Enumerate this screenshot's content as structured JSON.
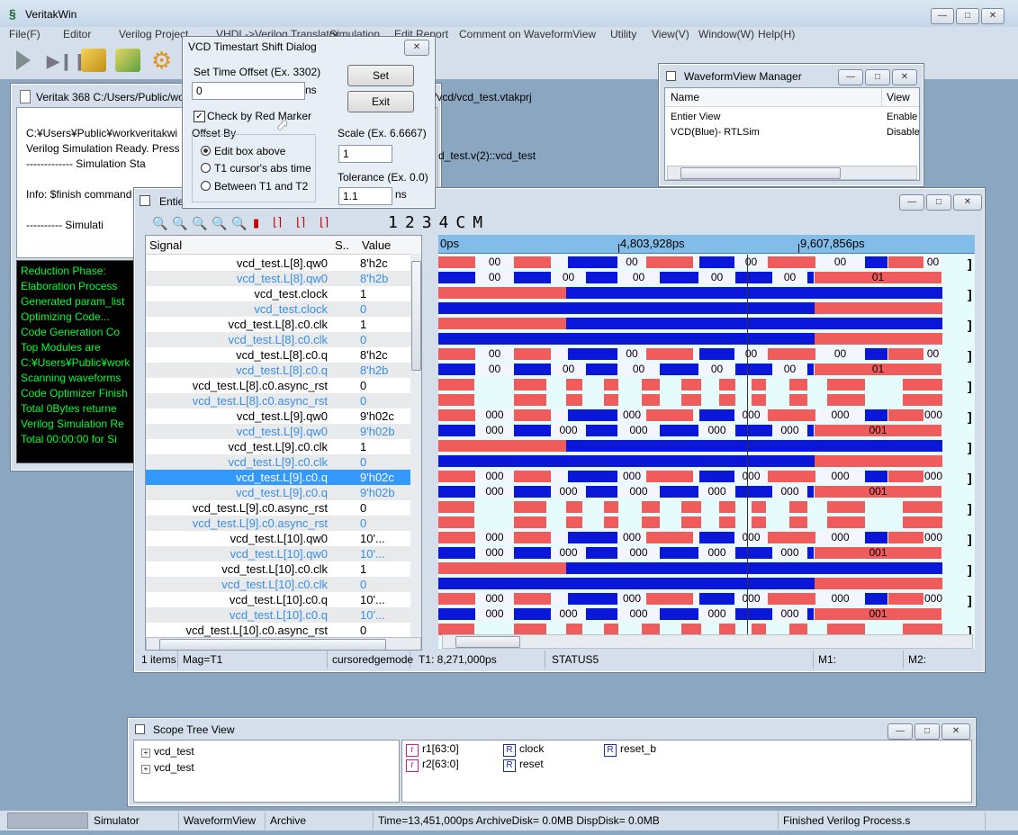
{
  "app": {
    "title": "VeritakWin",
    "menu": [
      "File(F)",
      "Editor",
      "Verilog Project",
      "VHDL->Verilog Translator",
      "Simulation",
      "Edit Report",
      "Comment on WaveformView",
      "Utility",
      "View(V)",
      "Window(W)",
      "Help(H)"
    ]
  },
  "console": {
    "title": "Veritak 368 C:/Users/Public/wo",
    "title_tail": "/vcd/vcd_test.vtakprj",
    "lines": [
      "C:¥Users¥Public¥workveritakwi",
      "Verilog Simulation Ready. Press",
      "------------- Simulation Sta",
      "",
      "Info: $finish command",
      "",
      "---------- Simulati"
    ],
    "line_tail": "d_test.v(2)::vcd_test"
  },
  "log": {
    "lines": [
      "Reduction Phase:",
      " Elaboration Process",
      "  Generated param_list",
      "  Optimizing Code...",
      " Code Generation Co",
      "Top Modules are",
      "C:¥Users¥Public¥work",
      "Scanning waveforms",
      "Code Optimizer Finish",
      "Total 0Bytes returne",
      "Verilog Simulation Re",
      "Total  00:00:00 for Si"
    ]
  },
  "dialog": {
    "title": "VCD Timestart Shift Dialog",
    "offset_label": "Set Time Offset  (Ex. 3302)",
    "offset_value": "0",
    "offset_unit": "ns",
    "set_btn": "Set",
    "exit_btn": "Exit",
    "check_label": "Check by Red Marker",
    "offset_by": "Offset By",
    "radios": [
      "Edit box above",
      "T1 cursor's abs time",
      "Between T1 and T2"
    ],
    "scale_label": "Scale  (Ex. 6.6667)",
    "scale_value": "1",
    "tolerance_label": "Tolerance (Ex. 0.0)",
    "tolerance_value": "1.1",
    "tolerance_unit": "ns"
  },
  "manager": {
    "title": "WaveformView Manager",
    "col_name": "Name",
    "col_view": "View",
    "rows": [
      {
        "name": "Entier View",
        "view": "Enable"
      },
      {
        "name": "VCD(Blue)- RTLSim",
        "view": "Disable"
      }
    ]
  },
  "waveform": {
    "title": "Entie",
    "toolbar_labels": [
      "1",
      "2",
      "3",
      "4",
      "C",
      "M"
    ],
    "col_signal": "Signal",
    "col_s": "S..",
    "col_value": "Value",
    "timeline": [
      "0ps",
      "4,803,928ps",
      "9,607,856ps"
    ],
    "status": {
      "items": "1 items",
      "mag": "Mag=T1",
      "mode": "cursoredgemode",
      "t1": "T1: 8,271,000ps",
      "status": "STATUS5",
      "m1": "M1:",
      "m2": "M2:"
    },
    "signals": [
      {
        "name": "vcd_test.L[8].qw0",
        "value": "8'h2c",
        "blue": false
      },
      {
        "name": "vcd_test.L[8].qw0",
        "value": "8'h2b",
        "blue": true
      },
      {
        "name": "vcd_test.clock",
        "value": "1",
        "blue": false
      },
      {
        "name": "vcd_test.clock",
        "value": "0",
        "blue": true
      },
      {
        "name": "vcd_test.L[8].c0.clk",
        "value": "1",
        "blue": false
      },
      {
        "name": "vcd_test.L[8].c0.clk",
        "value": "0",
        "blue": true
      },
      {
        "name": "vcd_test.L[8].c0.q",
        "value": "8'h2c",
        "blue": false
      },
      {
        "name": "vcd_test.L[8].c0.q",
        "value": "8'h2b",
        "blue": true
      },
      {
        "name": "vcd_test.L[8].c0.async_rst",
        "value": "0",
        "blue": false
      },
      {
        "name": "vcd_test.L[8].c0.async_rst",
        "value": "0",
        "blue": true
      },
      {
        "name": "vcd_test.L[9].qw0",
        "value": "9'h02c",
        "blue": false
      },
      {
        "name": "vcd_test.L[9].qw0",
        "value": "9'h02b",
        "blue": true
      },
      {
        "name": "vcd_test.L[9].c0.clk",
        "value": "1",
        "blue": false
      },
      {
        "name": "vcd_test.L[9].c0.clk",
        "value": "0",
        "blue": true
      },
      {
        "name": "vcd_test.L[9].c0.q",
        "value": "9'h02c",
        "blue": false,
        "selected": true
      },
      {
        "name": "vcd_test.L[9].c0.q",
        "value": "9'h02b",
        "blue": true
      },
      {
        "name": "vcd_test.L[9].c0.async_rst",
        "value": "0",
        "blue": false
      },
      {
        "name": "vcd_test.L[9].c0.async_rst",
        "value": "0",
        "blue": true
      },
      {
        "name": "vcd_test.L[10].qw0",
        "value": "10'...",
        "blue": false
      },
      {
        "name": "vcd_test.L[10].qw0",
        "value": "10'...",
        "blue": true
      },
      {
        "name": "vcd_test.L[10].c0.clk",
        "value": "1",
        "blue": false
      },
      {
        "name": "vcd_test.L[10].c0.clk",
        "value": "0",
        "blue": true
      },
      {
        "name": "vcd_test.L[10].c0.q",
        "value": "10'...",
        "blue": false
      },
      {
        "name": "vcd_test.L[10].c0.q",
        "value": "10'...",
        "blue": true
      },
      {
        "name": "vcd_test.L[10].c0.async_rst",
        "value": "0",
        "blue": false
      }
    ],
    "bus_labels": {
      "a": "00",
      "b": "01",
      "c": "000",
      "d": "001"
    }
  },
  "scope": {
    "title": "Scope Tree View",
    "tree": [
      "vcd_test",
      "vcd_test"
    ],
    "items": [
      {
        "label": "r1[63:0]",
        "kind": "r"
      },
      {
        "label": "r2[63:0]",
        "kind": "r"
      },
      {
        "label": "clock",
        "kind": "R"
      },
      {
        "label": "reset",
        "kind": "R"
      },
      {
        "label": "reset_b",
        "kind": "R"
      }
    ]
  },
  "statusbar": {
    "cells": [
      "Simulator",
      "WaveformView",
      "Archive",
      "Time=13,451,000ps ArchiveDisk=  0.0MB DispDisk=  0.0MB",
      "Finished Verilog Process.s"
    ]
  },
  "colors": {
    "red": "#f05b5b",
    "blue": "#0a16d8",
    "selected": "#3399ff",
    "log_green": "#00ff33"
  }
}
